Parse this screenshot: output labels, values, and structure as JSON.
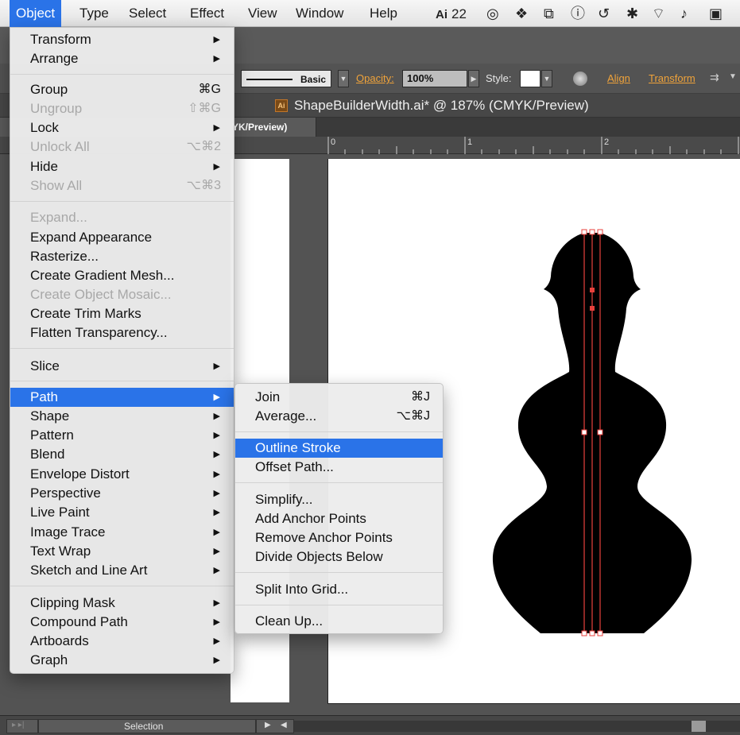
{
  "menubar": {
    "items": [
      "Object",
      "Type",
      "Select",
      "Effect",
      "View",
      "Window",
      "Help"
    ],
    "tray_ai_count": "22"
  },
  "control_bar": {
    "stroke_profile": "Basic",
    "opacity_label": "Opacity:",
    "opacity_value": "100%",
    "style_label": "Style:",
    "align_label": "Align",
    "transform_label": "Transform"
  },
  "document": {
    "title": "ShapeBuilderWidth.ai* @ 187% (CMYK/Preview)",
    "tab_label": "YK/Preview)",
    "ai_icon": "Ai"
  },
  "ruler": {
    "ticks": [
      "0",
      "1",
      "2"
    ]
  },
  "object_menu": {
    "items": [
      {
        "label": "Transform",
        "submenu": true
      },
      {
        "label": "Arrange",
        "submenu": true
      },
      {
        "label": "Group",
        "shortcut": "⌘G"
      },
      {
        "label": "Ungroup",
        "shortcut": "⇧⌘G",
        "disabled": true
      },
      {
        "label": "Lock",
        "submenu": true
      },
      {
        "label": "Unlock All",
        "shortcut": "⌥⌘2",
        "disabled": true
      },
      {
        "label": "Hide",
        "submenu": true
      },
      {
        "label": "Show All",
        "shortcut": "⌥⌘3",
        "disabled": true
      },
      {
        "label": "Expand...",
        "disabled": true
      },
      {
        "label": "Expand Appearance"
      },
      {
        "label": "Rasterize..."
      },
      {
        "label": "Create Gradient Mesh..."
      },
      {
        "label": "Create Object Mosaic...",
        "disabled": true
      },
      {
        "label": "Create Trim Marks"
      },
      {
        "label": "Flatten Transparency..."
      },
      {
        "label": "Slice",
        "submenu": true
      },
      {
        "label": "Path",
        "submenu": true,
        "highlight": true
      },
      {
        "label": "Shape",
        "submenu": true
      },
      {
        "label": "Pattern",
        "submenu": true
      },
      {
        "label": "Blend",
        "submenu": true
      },
      {
        "label": "Envelope Distort",
        "submenu": true
      },
      {
        "label": "Perspective",
        "submenu": true
      },
      {
        "label": "Live Paint",
        "submenu": true
      },
      {
        "label": "Image Trace",
        "submenu": true
      },
      {
        "label": "Text Wrap",
        "submenu": true
      },
      {
        "label": "Sketch and Line Art",
        "submenu": true
      },
      {
        "label": "Clipping Mask",
        "submenu": true
      },
      {
        "label": "Compound Path",
        "submenu": true
      },
      {
        "label": "Artboards",
        "submenu": true
      },
      {
        "label": "Graph",
        "submenu": true
      }
    ]
  },
  "path_submenu": {
    "items": [
      {
        "label": "Join",
        "shortcut": "⌘J"
      },
      {
        "label": "Average...",
        "shortcut": "⌥⌘J"
      },
      {
        "label": "Outline Stroke",
        "highlight": true
      },
      {
        "label": "Offset Path..."
      },
      {
        "label": "Simplify..."
      },
      {
        "label": "Add Anchor Points"
      },
      {
        "label": "Remove Anchor Points"
      },
      {
        "label": "Divide Objects Below"
      },
      {
        "label": "Split Into Grid..."
      },
      {
        "label": "Clean Up..."
      }
    ]
  },
  "status_bar": {
    "tool_label": "Selection"
  },
  "colors": {
    "menu_highlight": "#2a73e8",
    "selection": "#e8413c",
    "opacity_link": "#f0a33a"
  }
}
